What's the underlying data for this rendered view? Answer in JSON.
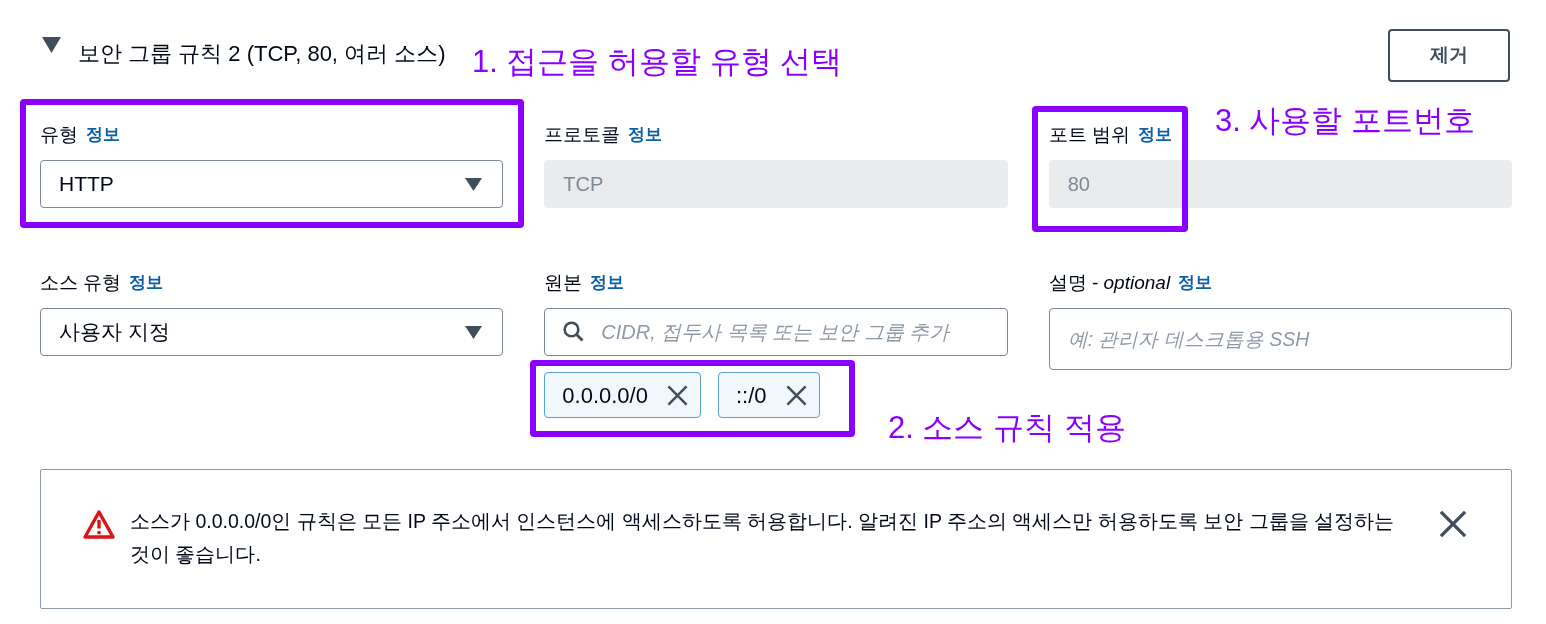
{
  "rule": {
    "title": "보안 그룹 규칙 2 (TCP, 80, 여러 소스)",
    "expanded": true,
    "remove_button": "제거"
  },
  "fields": [
    {
      "kind": "select",
      "label": "유형",
      "info_link": "정보",
      "value": "HTTP",
      "disabled": false
    },
    {
      "kind": "text",
      "label": "프로토콜",
      "info_link": "정보",
      "value": "TCP",
      "disabled": true
    },
    {
      "kind": "text",
      "label": "포트 범위",
      "info_link": "정보",
      "value": "80",
      "disabled": true
    },
    {
      "kind": "select",
      "label": "소스 유형",
      "info_link": "정보",
      "value": "사용자 지정",
      "disabled": false
    },
    {
      "kind": "search",
      "label": "원본",
      "info_link": "정보",
      "placeholder": "CIDR, 접두사 목록 또는 보안 그룹 추가",
      "disabled": false,
      "tokens": [
        "0.0.0.0/0",
        "::/0"
      ]
    },
    {
      "kind": "textarea",
      "label": "설명 - *optional*",
      "info_link": "정보",
      "placeholder": "예: 관리자 데스크톱용 SSH",
      "disabled": false
    }
  ],
  "alert": {
    "text": "소스가 0.0.0.0/0인 규칙은 모든 IP 주소에서 인스턴스에 액세스하도록 허용합니다. 알려진 IP 주소의 액세스만 허용하도록 보안 그룹을 설정하는 것이 좋습니다."
  },
  "annotations": [
    {
      "label": "1. 접근을 허용할 유형 선택"
    },
    {
      "label": "3. 사용할 포트번호"
    },
    {
      "label": "2. 소스 규칙 적용"
    }
  ]
}
